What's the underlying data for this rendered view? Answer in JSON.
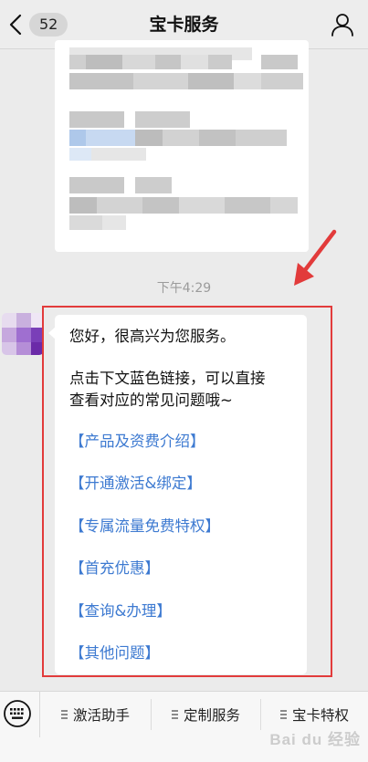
{
  "header": {
    "title": "宝卡服务",
    "unread_count": "52"
  },
  "chat": {
    "timestamp": "下午4:29",
    "message": {
      "greeting": "您好，很高兴为您服务。",
      "instruction_line1": "点击下文蓝色链接，可以直接",
      "instruction_line2": "查看对应的常见问题哦~",
      "links": [
        "【产品及资费介绍】",
        "【开通激活&绑定】",
        "【专属流量免费特权】",
        "【首充优惠】",
        "【查询&办理】",
        "【其他问题】"
      ]
    }
  },
  "bottom_menu": {
    "items": [
      "激活助手",
      "定制服务",
      "宝卡特权"
    ]
  },
  "watermark": "Bai du 经验",
  "colors": {
    "link": "#3d7ad1",
    "highlight": "#e23b3b",
    "chat_background": "#ebebeb"
  },
  "icons": {
    "back": "chevron-left-icon",
    "profile": "person-icon",
    "keyboard": "keyboard-icon",
    "menu": "menu-lines-icon"
  }
}
